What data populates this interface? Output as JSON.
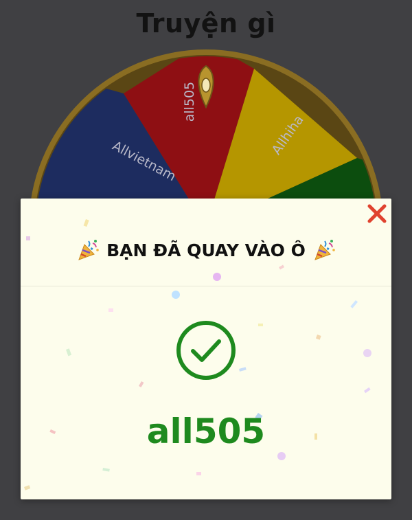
{
  "page": {
    "title": "Truyện gì"
  },
  "wheel": {
    "segments": [
      {
        "label": "Allvietnam",
        "color": "#1d2c5f"
      },
      {
        "label": "all505",
        "color": "#8e0f13"
      },
      {
        "label": "Allhiha",
        "color": "#b59600"
      },
      {
        "label": "",
        "color": "#0c4d0e"
      }
    ],
    "rim_color": "#8a6d22",
    "pointer_color": "#b8942e"
  },
  "modal": {
    "title": "BẠN ĐÃ QUAY VÀO Ô",
    "result": "all505",
    "close_icon": "close-icon",
    "success_icon": "check-circle-icon",
    "party_icon": "party-popper-icon",
    "accent_color": "#1e8a1e",
    "close_color": "#e0432f",
    "background": "#fdfdec"
  }
}
